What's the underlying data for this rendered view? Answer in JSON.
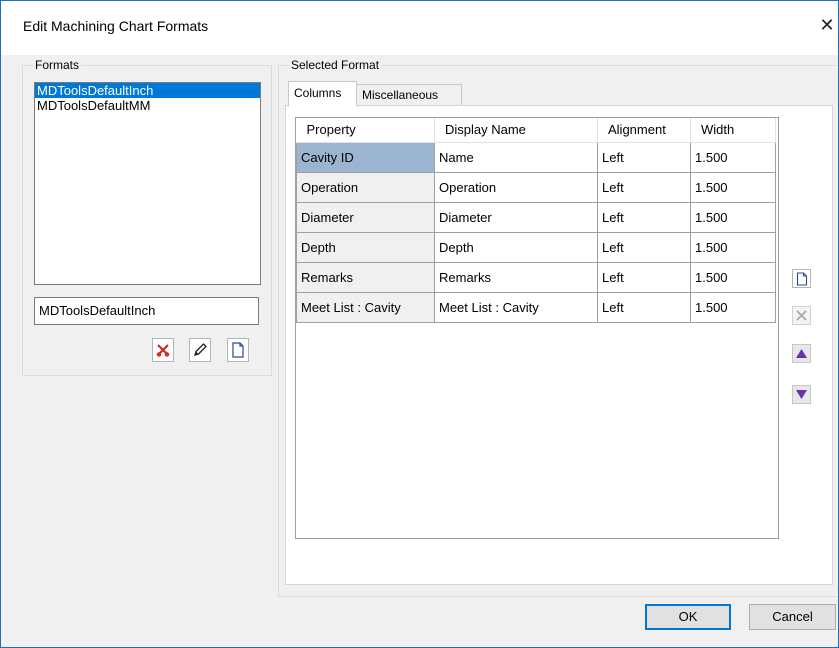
{
  "window": {
    "title": "Edit Machining Chart Formats",
    "close_glyph": "✕"
  },
  "formats": {
    "group_label": "Formats",
    "items": [
      "MDToolsDefaultInch",
      "MDToolsDefaultMM"
    ],
    "selected_index": 0,
    "name_value": "MDToolsDefaultInch",
    "icons": [
      "delete-icon",
      "edit-pencil-icon",
      "new-document-icon"
    ]
  },
  "selected_format": {
    "group_label": "Selected Format",
    "tabs": [
      {
        "label": "Columns",
        "active": true
      },
      {
        "label": "Miscellaneous",
        "active": false
      }
    ],
    "columns_table": {
      "headers": [
        "Property",
        "Display Name",
        "Alignment",
        "Width"
      ],
      "rows": [
        [
          "Cavity ID",
          "Name",
          "Left",
          "1.500"
        ],
        [
          "Operation",
          "Operation",
          "Left",
          "1.500"
        ],
        [
          "Diameter",
          "Diameter",
          "Left",
          "1.500"
        ],
        [
          "Depth",
          "Depth",
          "Left",
          "1.500"
        ],
        [
          "Remarks",
          "Remarks",
          "Left",
          "1.500"
        ],
        [
          "Meet List : Cavity",
          "Meet List : Cavity",
          "Left",
          "1.500"
        ]
      ],
      "selected_row": 0
    },
    "side_icons": [
      "new-document-icon",
      "delete-disabled-icon",
      "move-up-icon",
      "move-down-icon"
    ]
  },
  "buttons": {
    "ok": "OK",
    "cancel": "Cancel"
  },
  "colors": {
    "selection": "#0078d7",
    "accent_purple": "#6b2fb3",
    "delete_red": "#d22020",
    "frame_blue": "#1e6fb8"
  }
}
